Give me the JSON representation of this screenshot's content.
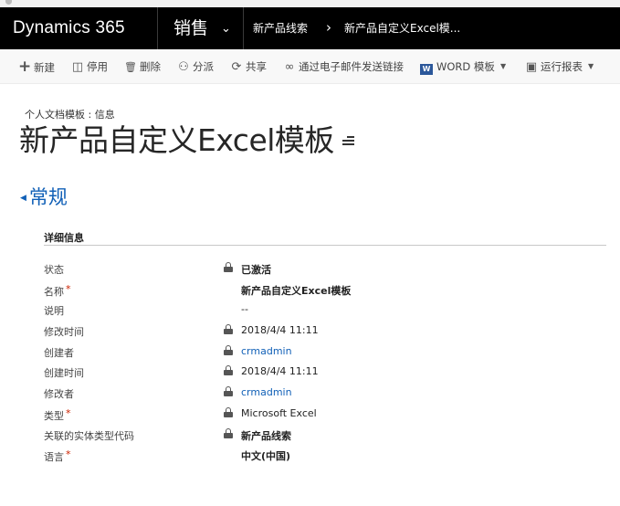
{
  "nav": {
    "app_name": "Dynamics 365",
    "area": "销售",
    "breadcrumb_entity": "新产品线索",
    "breadcrumb_separator": "›",
    "breadcrumb_record": "新产品自定义Excel模..."
  },
  "commands": [
    {
      "icon": "plus-icon",
      "glyph": "+",
      "label": "新建"
    },
    {
      "icon": "deactivate-icon",
      "glyph": "◫",
      "label": "停用"
    },
    {
      "icon": "delete-icon",
      "glyph": "🗑",
      "label": "删除"
    },
    {
      "icon": "assign-icon",
      "glyph": "⚇",
      "label": "分派"
    },
    {
      "icon": "share-icon",
      "glyph": "⟳",
      "label": "共享"
    },
    {
      "icon": "link-icon",
      "glyph": "∞",
      "label": "通过电子邮件发送链接"
    },
    {
      "icon": "word-icon",
      "glyph": "W",
      "label": "WORD 模板"
    },
    {
      "icon": "report-icon",
      "glyph": "▣",
      "label": "运行报表"
    }
  ],
  "header": {
    "entity_label": "个人文档模板 : 信息",
    "title": "新产品自定义Excel模板"
  },
  "section": {
    "title": "常规",
    "group_title": "详细信息"
  },
  "fields": [
    {
      "label": "状态",
      "required": false,
      "locked": true,
      "value": "已激活",
      "style": "bold"
    },
    {
      "label": "名称",
      "required": true,
      "locked": false,
      "value": "新产品自定义Excel模板",
      "style": "bold"
    },
    {
      "label": "说明",
      "required": false,
      "locked": false,
      "value": "--",
      "style": "plain"
    },
    {
      "label": "修改时间",
      "required": false,
      "locked": true,
      "value": "2018/4/4   11:11",
      "style": "plain"
    },
    {
      "label": "创建者",
      "required": false,
      "locked": true,
      "value": "crmadmin",
      "style": "link"
    },
    {
      "label": "创建时间",
      "required": false,
      "locked": true,
      "value": "2018/4/4   11:11",
      "style": "plain"
    },
    {
      "label": "修改者",
      "required": false,
      "locked": true,
      "value": "crmadmin",
      "style": "link"
    },
    {
      "label": "类型",
      "required": true,
      "locked": true,
      "value": "Microsoft Excel",
      "style": "plain"
    },
    {
      "label": "关联的实体类型代码",
      "required": false,
      "locked": true,
      "value": "新产品线索",
      "style": "bold"
    },
    {
      "label": "语言",
      "required": true,
      "locked": false,
      "value": "中文(中国)",
      "style": "bold"
    }
  ],
  "colors": {
    "nav_background": "#000000",
    "link": "#1160b7",
    "required_marker": "#cc2200"
  }
}
